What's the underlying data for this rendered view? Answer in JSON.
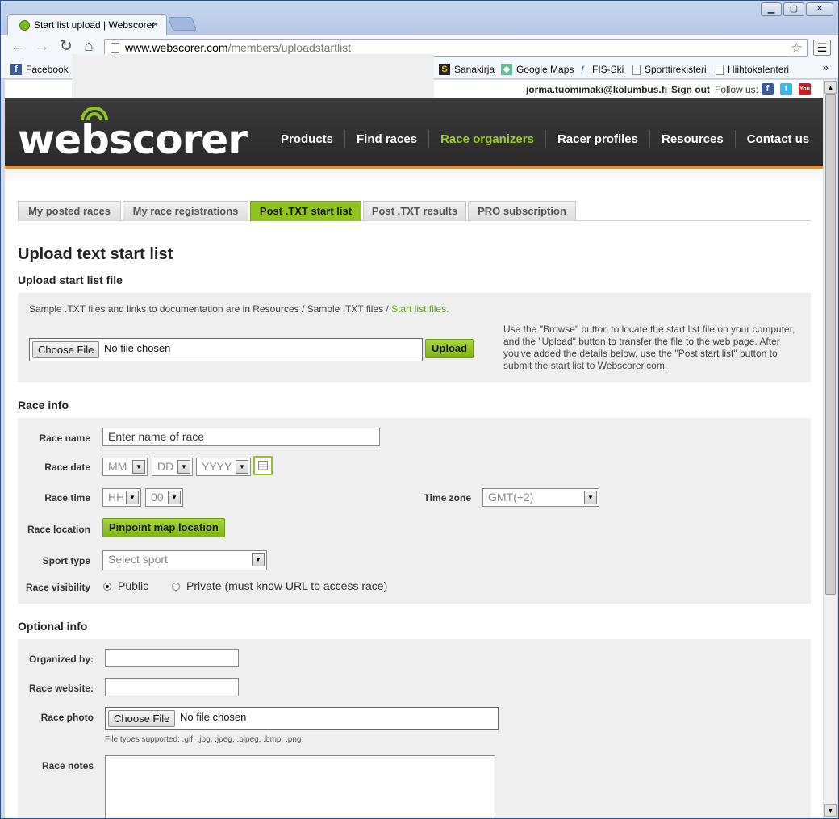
{
  "browser": {
    "tab_title": "Start list upload | Webscorer",
    "tab_close": "×",
    "url_host": "www.webscorer.com",
    "url_path": "/members/uploadstartlist",
    "bookmarks": [
      {
        "label": "Facebook",
        "icon": "facebook-icon",
        "color": "#3b5998"
      },
      {
        "label": "Sanakirja",
        "icon": "s-icon",
        "color": "#222"
      },
      {
        "label": "Google Maps",
        "icon": "maps-icon",
        "color": "#4a8"
      },
      {
        "label": "FIS-Ski",
        "icon": "fis-icon",
        "color": "#26a"
      },
      {
        "label": "Sporttirekisteri",
        "icon": "page-icon",
        "color": "#fff"
      },
      {
        "label": "Hiihtokalenteri",
        "icon": "page-icon",
        "color": "#fff"
      }
    ],
    "bookmarks_more": "»"
  },
  "account": {
    "email": "jorma.tuomimaki@kolumbus.fi",
    "sign_out": "Sign out",
    "follow_us": "Follow us:"
  },
  "header": {
    "logo": "webscorer",
    "nav": [
      "Products",
      "Find races",
      "Race organizers",
      "Racer profiles",
      "Resources",
      "Contact us"
    ],
    "active_nav": "Race organizers",
    "accent_color": "#9bcc2a",
    "orange_rule": "#f08a24"
  },
  "subtabs": [
    "My posted races",
    "My race registrations",
    "Post .TXT start list",
    "Post .TXT results",
    "PRO subscription"
  ],
  "page": {
    "title": "Upload text start list",
    "upload_section": "Upload start list file",
    "sample_text": "Sample .TXT files and links to documentation are in Resources / Sample .TXT files / ",
    "sample_link": "Start list files.",
    "choose_file": "Choose File",
    "no_file": "No file chosen",
    "upload_btn": "Upload",
    "help_text": "Use the \"Browse\" button to locate the start list file on your computer, and the \"Upload\" button to transfer the file to the web page. After you've added the details below, use the \"Post start list\" button to submit the start list to Webscorer.com."
  },
  "race_info": {
    "title": "Race info",
    "name_label": "Race name",
    "name_placeholder": "Enter name of race",
    "date_label": "Race date",
    "month": "MM",
    "day": "DD",
    "year": "YYYY",
    "time_label": "Race time",
    "hour": "HH",
    "minute": "00",
    "tz_label": "Time zone",
    "tz_value": "GMT(+2)",
    "location_label": "Race location",
    "location_btn": "Pinpoint map location",
    "sport_label": "Sport type",
    "sport_value": "Select sport",
    "visibility_label": "Race visibility",
    "vis_public": "Public",
    "vis_private": "Private (must know URL to access race)"
  },
  "optional_info": {
    "title": "Optional info",
    "organized_label": "Organized by:",
    "website_label": "Race website:",
    "photo_label": "Race photo",
    "choose_file": "Choose File",
    "no_file": "No file chosen",
    "file_types": "File types supported: .gif, .jpg, .jpeg, .pjpeg, .bmp, .png",
    "notes_label": "Race notes"
  }
}
